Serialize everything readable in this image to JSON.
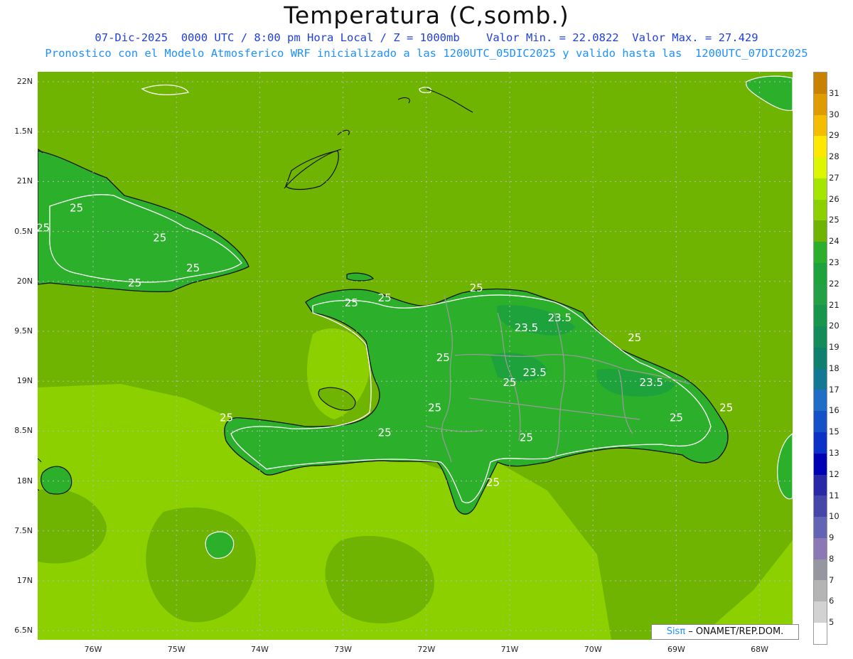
{
  "title": "Temperatura (C,somb.)",
  "subtitle1": "07-Dic-2025  0000 UTC / 8:00 pm Hora Local / Z = 1000mb    Valor Min. = 22.0822  Valor Max. = 27.429",
  "subtitle2": "Pronostico con el Modelo Atmosferico WRF inicializado a las 1200UTC_05DIC2025 y valido hasta las  1200UTC_07DIC2025",
  "credit": {
    "brand": "Sisπ",
    "text": " – ONAMET/REP.DOM."
  },
  "lat_labels": [
    {
      "label": "22N",
      "lat": 22.0
    },
    {
      "label": "1.5N",
      "lat": 21.5
    },
    {
      "label": "21N",
      "lat": 21.0
    },
    {
      "label": "0.5N",
      "lat": 20.5
    },
    {
      "label": "20N",
      "lat": 20.0
    },
    {
      "label": "9.5N",
      "lat": 19.5
    },
    {
      "label": "19N",
      "lat": 19.0
    },
    {
      "label": "8.5N",
      "lat": 18.5
    },
    {
      "label": "18N",
      "lat": 18.0
    },
    {
      "label": "7.5N",
      "lat": 17.5
    },
    {
      "label": "17N",
      "lat": 17.0
    },
    {
      "label": "6.5N",
      "lat": 16.5
    }
  ],
  "lon_labels": [
    {
      "label": "76W",
      "lon": -76
    },
    {
      "label": "75W",
      "lon": -75
    },
    {
      "label": "74W",
      "lon": -74
    },
    {
      "label": "73W",
      "lon": -73
    },
    {
      "label": "72W",
      "lon": -72
    },
    {
      "label": "71W",
      "lon": -71
    },
    {
      "label": "70W",
      "lon": -70
    },
    {
      "label": "69W",
      "lon": -69
    },
    {
      "label": "68W",
      "lon": -68
    }
  ],
  "colorbar": {
    "labels": [
      "31",
      "30",
      "29",
      "28",
      "27",
      "26",
      "25",
      "24",
      "23",
      "22",
      "21",
      "20",
      "19",
      "18",
      "17",
      "16",
      "15",
      "13",
      "12",
      "11",
      "10",
      "9",
      "8",
      "7",
      "6",
      "5"
    ],
    "colors": [
      "#c88200",
      "#e09b00",
      "#f5bd00",
      "#ffe800",
      "#dcf600",
      "#a4e600",
      "#8cd000",
      "#6eb400",
      "#2cb02c",
      "#1ea33c",
      "#22a046",
      "#19964e",
      "#148c5a",
      "#0f7f6e",
      "#127894",
      "#1e6ec8",
      "#1450c8",
      "#0a32c8",
      "#0000b4",
      "#2828a8",
      "#4646aa",
      "#6464b4",
      "#8c78b4",
      "#9696a0",
      "#b4b4b4",
      "#d2d2d2",
      "#ffffff"
    ]
  },
  "contour_labels": [
    {
      "text": "25",
      "lon": -76.2,
      "lat": 20.7
    },
    {
      "text": "25",
      "lon": -76.6,
      "lat": 20.5
    },
    {
      "text": "25",
      "lon": -75.2,
      "lat": 20.4
    },
    {
      "text": "25",
      "lon": -74.8,
      "lat": 20.1
    },
    {
      "text": "25",
      "lon": -75.5,
      "lat": 19.95
    },
    {
      "text": "25",
      "lon": -72.9,
      "lat": 19.75
    },
    {
      "text": "25",
      "lon": -72.5,
      "lat": 19.8
    },
    {
      "text": "25",
      "lon": -71.4,
      "lat": 19.9
    },
    {
      "text": "23.5",
      "lon": -70.8,
      "lat": 19.5
    },
    {
      "text": "23.5",
      "lon": -70.4,
      "lat": 19.6
    },
    {
      "text": "25",
      "lon": -69.5,
      "lat": 19.4
    },
    {
      "text": "25",
      "lon": -71.8,
      "lat": 19.2
    },
    {
      "text": "23.5",
      "lon": -70.7,
      "lat": 19.05
    },
    {
      "text": "25",
      "lon": -71.0,
      "lat": 18.95
    },
    {
      "text": "23.5",
      "lon": -69.3,
      "lat": 18.95
    },
    {
      "text": "25",
      "lon": -69.0,
      "lat": 18.6
    },
    {
      "text": "25",
      "lon": -68.4,
      "lat": 18.7
    },
    {
      "text": "25",
      "lon": -74.4,
      "lat": 18.6
    },
    {
      "text": "25",
      "lon": -72.5,
      "lat": 18.45
    },
    {
      "text": "25",
      "lon": -71.9,
      "lat": 18.7
    },
    {
      "text": "25",
      "lon": -70.8,
      "lat": 18.4
    },
    {
      "text": "25",
      "lon": -71.2,
      "lat": 17.95
    }
  ]
}
